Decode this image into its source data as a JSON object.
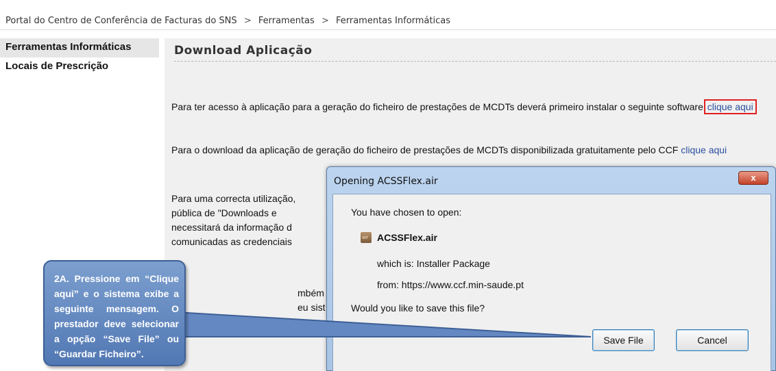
{
  "breadcrumb": {
    "items": [
      "Portal do Centro de Conferência de Facturas do SNS",
      "Ferramentas",
      "Ferramentas Informáticas"
    ],
    "separator": ">"
  },
  "sidebar": {
    "items": [
      {
        "label": "Ferramentas Informáticas",
        "active": true
      },
      {
        "label": "Locais de Prescrição",
        "active": false
      }
    ]
  },
  "main": {
    "title": "Download Aplicação",
    "paragraph1": {
      "text": "Para ter acesso à aplicação para a geração do ficheiro de prestações de MCDTs deverá primeiro instalar o seguinte software",
      "link": "clique aqui"
    },
    "paragraph2": {
      "text": "Para o download da aplicação de geração do ficheiro de prestações de MCDTs disponibilizada gratuitamente pelo CCF",
      "link": "clique aqui"
    },
    "paragraph3_visible_lines": [
      "Para uma correcta utilização,",
      "pública de \"Downloads e",
      "necessitará da informação d",
      "comunicadas as credenciais"
    ],
    "paragraph4_visible_lines": [
      "mbém",
      "eu sist"
    ]
  },
  "dialog": {
    "title": "Opening ACSSFlex.air",
    "close_label": "x",
    "prompt": "You have chosen to open:",
    "file_icon": "air-package-icon",
    "file_icon_text": "air",
    "file_name": "ACSSFlex.air",
    "which_is_label": "which is:",
    "which_is_value": "Installer Package",
    "from_label": "from:",
    "from_value": "https://www.ccf.min-saude.pt",
    "question": "Would you like to save this file?",
    "save_label": "Save File",
    "cancel_label": "Cancel"
  },
  "callout": {
    "text": "2A. Pressione em “Clique aqui” e o sistema exibe a seguinte mensagem. O prestador deve selecionar a opção “Save File” ou “Guardar Ficheiro”.",
    "color": "#5f86c0"
  }
}
